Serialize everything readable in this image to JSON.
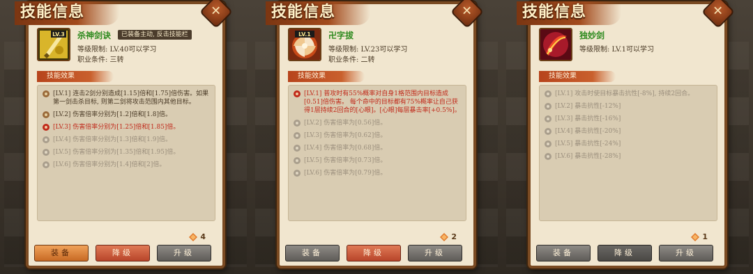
{
  "panels": [
    {
      "title": "技能信息",
      "icon": "sword-skill-icon",
      "level_badge": "LV.3",
      "name": "杀神剑诀",
      "equip_tag": "已装备主动, 反击技能栏",
      "requirement_level": "等级限制: LV.40可以学习",
      "requirement_class": "职业条件: 三转",
      "effects_header": "技能效果",
      "effects": [
        {
          "state": "done",
          "text": "[LV.1] 连击2剑分别造成[1.15]倍和[1.75]倍伤害。如果第一剑击杀目标, 则第二剑将攻击范围内其他目标。"
        },
        {
          "state": "done",
          "text": "[LV.2] 伤害倍率分别为[1.2]倍和[1.8]倍。"
        },
        {
          "state": "current",
          "text": "[LV.3] 伤害倍率分别为[1.25]倍和[1.85]倍。"
        },
        {
          "state": "locked",
          "text": "[LV.4] 伤害倍率分别为[1.3]倍和[1.9]倍。"
        },
        {
          "state": "locked",
          "text": "[LV.5] 伤害倍率分别为[1.35]倍和[1.95]倍。"
        },
        {
          "state": "locked",
          "text": "[LV.6] 伤害倍率分别为[1.4]倍和[2]倍。"
        }
      ],
      "cost": "4",
      "buttons": [
        {
          "label": "装备",
          "style": "orange"
        },
        {
          "label": "降级",
          "style": "red"
        },
        {
          "label": "升级",
          "style": "gray"
        }
      ]
    },
    {
      "title": "技能信息",
      "icon": "vortex-skill-icon",
      "level_badge": "LV.1",
      "name": "卍字拔",
      "equip_tag": "",
      "requirement_level": "等级限制: LV.23可以学习",
      "requirement_class": "职业条件: 二转",
      "effects_header": "技能效果",
      "effects": [
        {
          "state": "current",
          "text": "[LV.1] 普攻时有55%概率对自身1格范围内目标造成[0.51]倍伤害。 每个命中的目标都有75%概率让自己获得1层持续2回合的[心眼]。[心眼]每层暴击率[+0.5%]。"
        },
        {
          "state": "locked",
          "text": "[LV.2] 伤害倍率为[0.56]倍。"
        },
        {
          "state": "locked",
          "text": "[LV.3] 伤害倍率为[0.62]倍。"
        },
        {
          "state": "locked",
          "text": "[LV.4] 伤害倍率为[0.68]倍。"
        },
        {
          "state": "locked",
          "text": "[LV.5] 伤害倍率为[0.73]倍。"
        },
        {
          "state": "locked",
          "text": "[LV.6] 伤害倍率为[0.79]倍。"
        }
      ],
      "cost": "2",
      "buttons": [
        {
          "label": "装备",
          "style": "gray"
        },
        {
          "label": "降级",
          "style": "red"
        },
        {
          "label": "升级",
          "style": "gray"
        }
      ]
    },
    {
      "title": "技能信息",
      "icon": "slash-skill-icon",
      "level_badge": "",
      "name": "独妙剑",
      "equip_tag": "",
      "requirement_level": "等级限制: LV.1可以学习",
      "requirement_class": "",
      "effects_header": "技能效果",
      "effects": [
        {
          "state": "locked",
          "text": "[LV.1] 攻击时使目标暴击抗性[-8%], 持续2回合。"
        },
        {
          "state": "locked",
          "text": "[LV.2] 暴击抗性[-12%]"
        },
        {
          "state": "locked",
          "text": "[LV.3] 暴击抗性[-16%]"
        },
        {
          "state": "locked",
          "text": "[LV.4] 暴击抗性[-20%]"
        },
        {
          "state": "locked",
          "text": "[LV.5] 暴击抗性[-24%]"
        },
        {
          "state": "locked",
          "text": "[LV.6] 暴击抗性[-28%]"
        }
      ],
      "cost": "1",
      "buttons": [
        {
          "label": "装备",
          "style": "gray"
        },
        {
          "label": "降级",
          "style": "dark"
        },
        {
          "label": "升级",
          "style": "gray"
        }
      ]
    }
  ]
}
